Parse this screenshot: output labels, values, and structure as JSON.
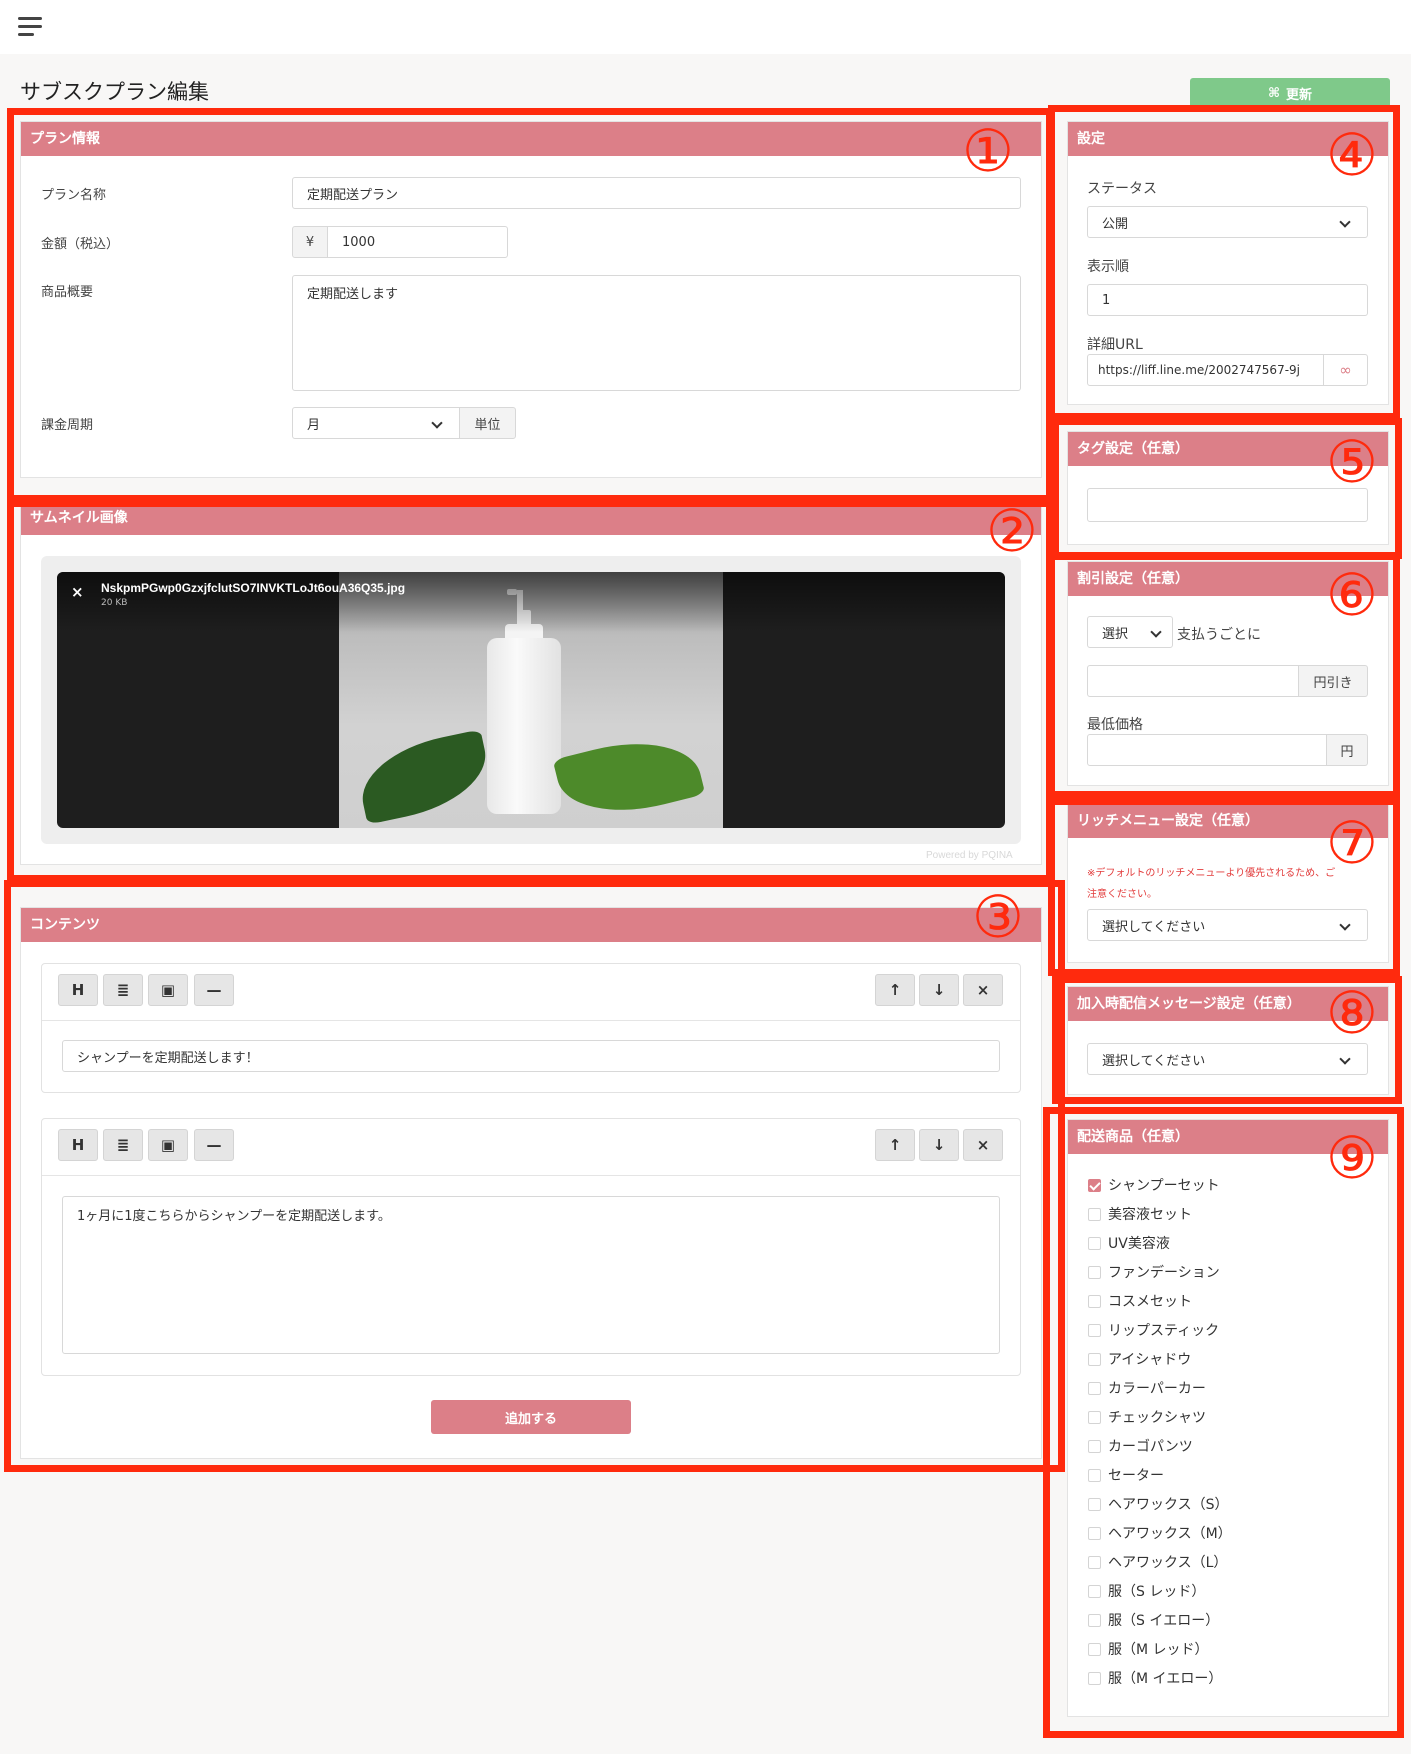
{
  "header": {
    "title": "サブスクプラン編集",
    "update_label": "更新"
  },
  "plan_info": {
    "header": "プラン情報",
    "name_label": "プラン名称",
    "name_value": "定期配送プラン",
    "price_label": "金額（税込）",
    "currency": "¥",
    "price_value": "1000",
    "summary_label": "商品概要",
    "summary_value": "定期配送します",
    "cycle_label": "課金周期",
    "cycle_value": "月",
    "cycle_unit": "単位"
  },
  "thumbnail": {
    "header": "サムネイル画像",
    "filename": "NskpmPGwp0GzxjfclutSO7INVKTLoJt6ouA36Q35.jpg",
    "filesize": "20 KB",
    "close_glyph": "×",
    "powered": "Powered by PQINA"
  },
  "contents": {
    "header": "コンテンツ",
    "tools": [
      "H",
      "≣",
      "▣",
      "—"
    ],
    "move_tools": [
      "↑",
      "↓",
      "×"
    ],
    "block1_value": "シャンプーを定期配送します！",
    "block2_value": "1ヶ月に1度こちらからシャンプーを定期配送します。",
    "add_label": "追加する"
  },
  "settings": {
    "header": "設定",
    "status_label": "ステータス",
    "status_value": "公開",
    "order_label": "表示順",
    "order_value": "1",
    "url_label": "詳細URL",
    "url_value": "https://liff.line.me/2002747567-9j"
  },
  "tags": {
    "header": "タグ設定（任意）"
  },
  "discount": {
    "header": "割引設定（任意）",
    "select_value": "選択",
    "per_payment": "支払うごとに",
    "yen_off": "円引き",
    "min_label": "最低価格",
    "yen": "円"
  },
  "richmenu": {
    "header": "リッチメニュー設定（任意）",
    "note_line1": "※デフォルトのリッチメニューより優先されるため、ご",
    "note_line2": "注意ください。",
    "select_value": "選択してください"
  },
  "join_message": {
    "header": "加入時配信メッセージ設定（任意）",
    "select_value": "選択してください"
  },
  "shipping": {
    "header": "配送商品（任意）",
    "items": [
      {
        "label": "シャンプーセット",
        "checked": true
      },
      {
        "label": "美容液セット",
        "checked": false
      },
      {
        "label": "UV美容液",
        "checked": false
      },
      {
        "label": "ファンデーション",
        "checked": false
      },
      {
        "label": "コスメセット",
        "checked": false
      },
      {
        "label": "リップスティック",
        "checked": false
      },
      {
        "label": "アイシャドウ",
        "checked": false
      },
      {
        "label": "カラーパーカー",
        "checked": false
      },
      {
        "label": "チェックシャツ",
        "checked": false
      },
      {
        "label": "カーゴパンツ",
        "checked": false
      },
      {
        "label": "セーター",
        "checked": false
      },
      {
        "label": "ヘアワックス（S）",
        "checked": false
      },
      {
        "label": "ヘアワックス（M）",
        "checked": false
      },
      {
        "label": "ヘアワックス（L）",
        "checked": false
      },
      {
        "label": "服（S レッド）",
        "checked": false
      },
      {
        "label": "服（S イエロー）",
        "checked": false
      },
      {
        "label": "服（M レッド）",
        "checked": false
      },
      {
        "label": "服（M イエロー）",
        "checked": false
      }
    ]
  },
  "annotations": [
    "①",
    "②",
    "③",
    "④",
    "⑤",
    "⑥",
    "⑦",
    "⑧",
    "⑨"
  ],
  "colors": {
    "accent": "#dc7f88",
    "annotation": "#ff2a0d",
    "update_button": "#7fc98a"
  }
}
